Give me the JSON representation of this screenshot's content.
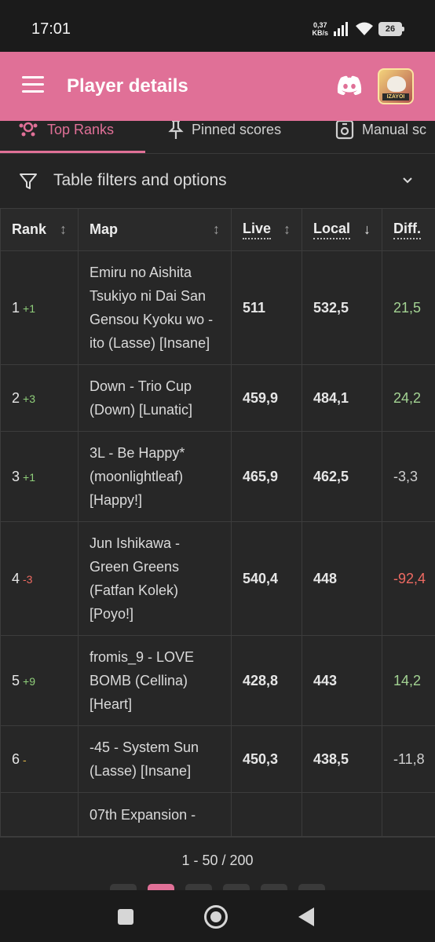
{
  "status_bar": {
    "time": "17:01",
    "net_speed_value": "0,37",
    "net_speed_unit": "KB/s",
    "battery": "26"
  },
  "app_bar": {
    "title": "Player details",
    "avatar_tag": "IZAYOI",
    "icons": [
      "menu-icon",
      "discord-icon",
      "avatar"
    ]
  },
  "tabs": [
    {
      "label": "Top Ranks",
      "active": true
    },
    {
      "label": "Pinned scores",
      "active": false
    },
    {
      "label": "Manual sc",
      "active": false
    }
  ],
  "filters": {
    "label": "Table filters and options"
  },
  "table": {
    "headers": {
      "rank": "Rank",
      "map": "Map",
      "live": "Live",
      "local": "Local",
      "diff": "Diff."
    },
    "rows": [
      {
        "rank": "1",
        "delta": "+1",
        "map": "Emiru no Aishita Tsukiyo ni Dai San Gensou Kyoku wo - ito (Lasse) [Insane]",
        "live": "511",
        "local": "532,5",
        "diff": "21,5"
      },
      {
        "rank": "2",
        "delta": "+3",
        "map": "Down - Trio Cup (Down) [Lunatic]",
        "live": "459,9",
        "local": "484,1",
        "diff": "24,2"
      },
      {
        "rank": "3",
        "delta": "+1",
        "map": "3L - Be Happy* (moonlightleaf) [Happy!]",
        "live": "465,9",
        "local": "462,5",
        "diff": "-3,3"
      },
      {
        "rank": "4",
        "delta": "-3",
        "map": "Jun Ishikawa - Green Greens (Fatfan Kolek) [Poyo!]",
        "live": "540,4",
        "local": "448",
        "diff": "-92,4"
      },
      {
        "rank": "5",
        "delta": "+9",
        "map": "fromis_9 - LOVE BOMB (Cellina) [Heart]",
        "live": "428,8",
        "local": "443",
        "diff": "14,2"
      },
      {
        "rank": "6",
        "delta": "-",
        "map": "-45 - System Sun (Lasse) [Insane]",
        "live": "450,3",
        "local": "438,5",
        "diff": "-11,8"
      },
      {
        "rank": "",
        "delta": "",
        "map": "07th Expansion -",
        "live": "",
        "local": "",
        "diff": ""
      }
    ]
  },
  "pagination": {
    "summary": "1 - 50 / 200"
  },
  "colors": {
    "accent": "#e07097",
    "positive": "#8fcf7a",
    "negative": "#ef6a62",
    "neutral": "#e0b84a",
    "background": "#242424"
  }
}
